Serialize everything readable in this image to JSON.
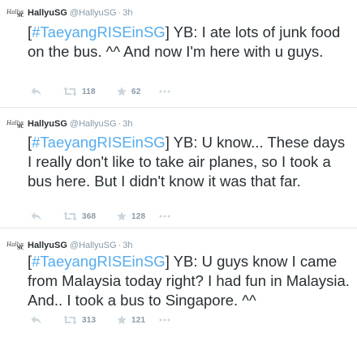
{
  "tweets": [
    {
      "display_name": "HallyuSG",
      "handle": "@HallyuSG",
      "separator": "·",
      "time": "3h",
      "hashtag": "#TaeyangRISEinSG",
      "text_before": "[",
      "text_bracket_close": "]",
      "text_body": " YB: I ate lots of junk food on the bus. ^^ And now I'm here with u guys.",
      "retweet_count": "118",
      "favorite_count": "62"
    },
    {
      "display_name": "HallyuSG",
      "handle": "@HallyuSG",
      "separator": "·",
      "time": "3h",
      "hashtag": "#TaeyangRISEinSG",
      "text_before": "[",
      "text_bracket_close": "]",
      "text_body": " YB: U know... These days I really don't like to take air planes, so I took a bus here. But I didn't know it was that far.",
      "retweet_count": "368",
      "favorite_count": "128"
    },
    {
      "display_name": "HallyuSG",
      "handle": "@HallyuSG",
      "separator": "·",
      "time": "3h",
      "hashtag": "#TaeyangRISEinSG",
      "text_before": "[",
      "text_bracket_close": "]",
      "text_body": " YB: U guys know I came from Malaysia today right? I had fun in Malaysia. And.. I took a bus to Singapore. ^^",
      "retweet_count": "313",
      "favorite_count": "121"
    }
  ],
  "icons": {
    "avatar": "hallyusg-logo",
    "reply": "reply-icon",
    "retweet": "retweet-icon",
    "favorite": "star-icon",
    "more": "more-icon"
  },
  "colors": {
    "hashtag": "#55acee",
    "text": "#292f33",
    "meta": "#8899a6",
    "action_icon": "#ccd6dd",
    "divider": "#e1e8ed"
  }
}
